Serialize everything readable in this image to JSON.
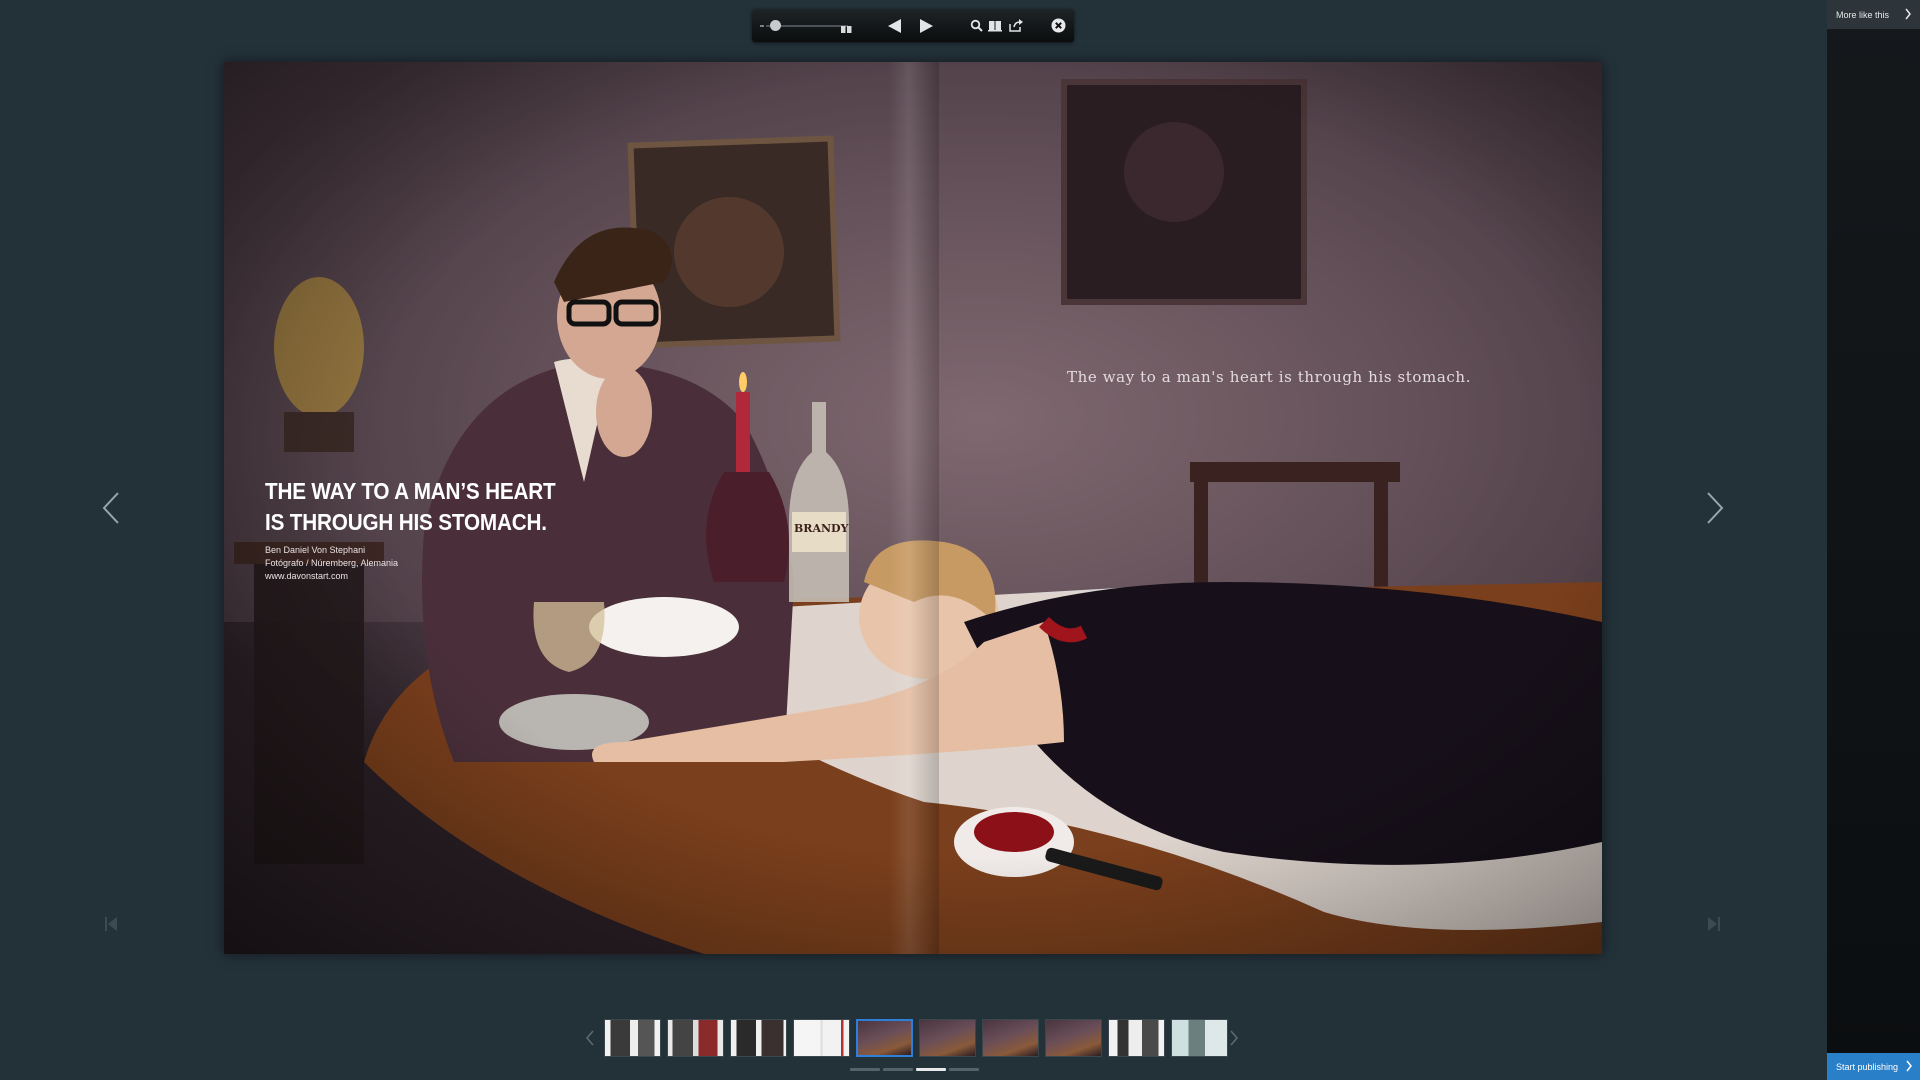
{
  "toolbar": {
    "zoom_level_fraction": 0.1,
    "icons": [
      "zoom-slider",
      "zoom-max-icon",
      "previous-page-icon",
      "next-page-icon",
      "search-icon",
      "pages-icon",
      "share-icon",
      "close-icon"
    ]
  },
  "page": {
    "headline_line1": "THE WAY TO A MAN’S HEART",
    "headline_line2": "IS THROUGH HIS STOMACH.",
    "credit_name": "Ben Daniel Von Stephani",
    "credit_role": "Fotógrafo / Núremberg, Alemania",
    "credit_url": "www.davonstart.com",
    "tagline": "The way to a man's heart is through his stomach.",
    "bottle_label": "BRANDY"
  },
  "thumbnails": {
    "count": 10,
    "active_index": 4
  },
  "progress": {
    "segments": 4,
    "active_index": 2
  },
  "right_panel": {
    "more_like_this": "More like this",
    "start_publishing": "Start publishing"
  },
  "colors": {
    "background": "#233139",
    "accent": "#2a7fc9",
    "active_thumb_border": "#2f7fd8"
  }
}
